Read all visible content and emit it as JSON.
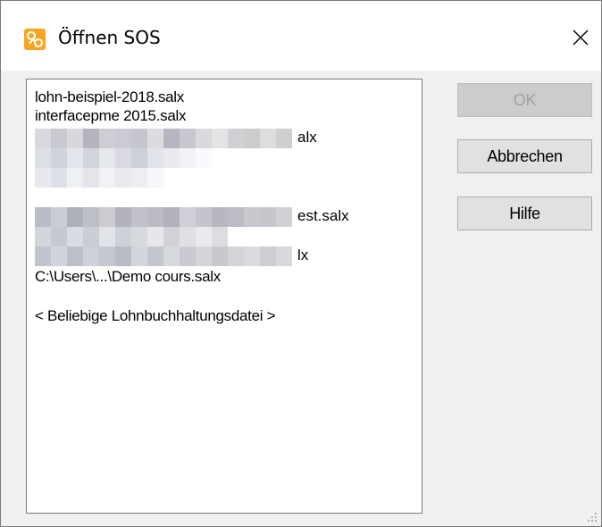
{
  "window": {
    "title": "Öffnen SOS",
    "icon": "sos-app-icon",
    "close_icon": "close-icon"
  },
  "file_list": {
    "items": [
      "lohn-beispiel-2018.salx",
      "interfacepme 2015.salx",
      "alx",
      "est.salx",
      "lx",
      "C:\\Users\\...\\Demo cours.salx",
      "< Beliebige Lohnbuchhaltungsdatei >"
    ]
  },
  "buttons": {
    "ok": "OK",
    "cancel": "Abbrechen",
    "help": "Hilfe"
  },
  "colors": {
    "accent_icon": "#f6a623",
    "disabled_text": "#a0a0a0"
  }
}
